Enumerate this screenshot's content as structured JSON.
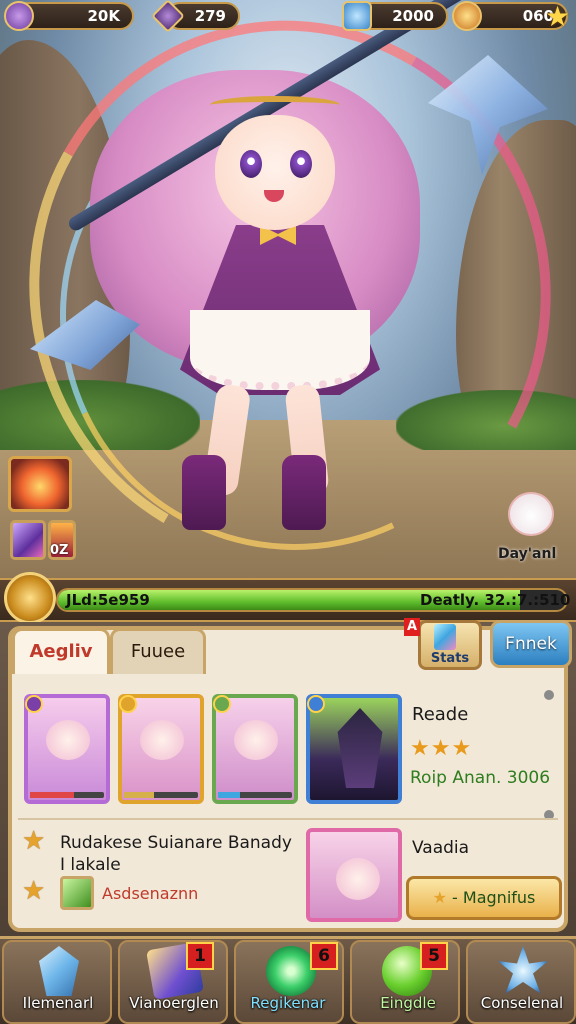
{
  "resources": [
    {
      "name": "gold-orb",
      "value": "20K"
    },
    {
      "name": "purple-gem",
      "value": "279"
    },
    {
      "name": "blue-shield",
      "value": "2000"
    },
    {
      "name": "gold-medal",
      "value": "060"
    }
  ],
  "hero": {
    "skill_count": "0Z",
    "pet_label": "Day'anl"
  },
  "xp": {
    "left_text": "JLd:5e959",
    "right_text": "Deatly. 32.:7.:510",
    "fill": 0.91
  },
  "panel": {
    "tabs": [
      "Aegliv",
      "Fuuee"
    ],
    "stats_label": "Stats",
    "stats_badge": "A",
    "freak_label": "Fnnek",
    "info": {
      "title": "Reade",
      "stars": "★★★",
      "subtitle": "Roip Anan. 3006"
    },
    "description": {
      "title": "Rudakese Suianare Banady I lakale",
      "leaf_label": "Asdsenaznn"
    },
    "portrait_name": "Vaadia",
    "magnifus_label": "- Magnifus"
  },
  "nav": [
    {
      "label": "Ilemenarl",
      "icon": "crystal-icon",
      "badge": ""
    },
    {
      "label": "Vianoerglen",
      "icon": "treasure-box-icon",
      "badge": "1"
    },
    {
      "label": "Regikenar",
      "icon": "swirl-icon",
      "badge": "6"
    },
    {
      "label": "Eingdle",
      "icon": "green-orb-icon",
      "badge": "5"
    },
    {
      "label": "Conselenal",
      "icon": "snowflake-icon",
      "badge": ""
    }
  ],
  "colors": {
    "accent_gold": "#c9a467",
    "xp_green": "#5fbd2c",
    "panel_bg": "#f2e8d8",
    "tab_active_text": "#c0392b"
  }
}
